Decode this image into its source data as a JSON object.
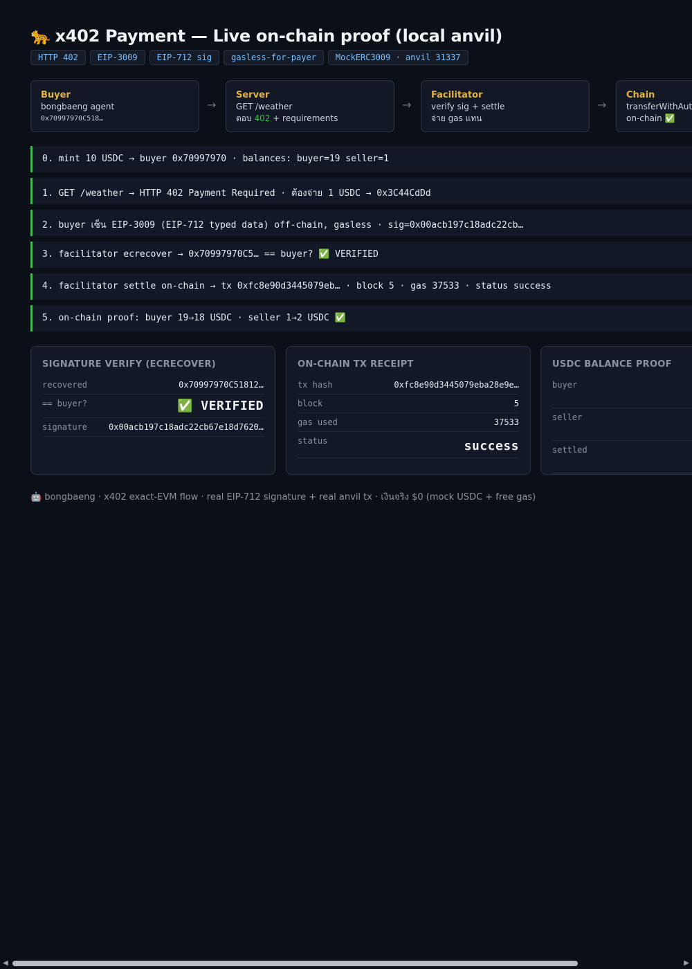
{
  "header": {
    "emoji": "🐆",
    "title": "x402 Payment — Live on-chain proof (local anvil)",
    "badges": [
      "HTTP 402",
      "EIP-3009",
      "EIP-712 sig",
      "gasless-for-payer",
      "MockERC3009 · anvil 31337"
    ]
  },
  "flow": {
    "arrow": "→",
    "cards": [
      {
        "name": "Buyer",
        "line1": "bongbaeng agent",
        "line2": "0x70997970C518…"
      },
      {
        "name": "Server",
        "line1": "GET /weather",
        "line2_pre": "ตอบ ",
        "line2_hl": "402",
        "line2_post": " + requirements"
      },
      {
        "name": "Facilitator",
        "line1": "verify sig + settle",
        "line2": "จ่าย gas แทน"
      },
      {
        "name": "Chain",
        "line1": "transferWithAuth",
        "line2": "on-chain ✅"
      }
    ]
  },
  "steps": [
    "0. mint 10 USDC → buyer 0x70997970 · balances: buyer=19 seller=1",
    "1. GET /weather → HTTP 402 Payment Required · ต้องจ่าย 1 USDC → 0x3C44CdDd",
    "2. buyer เซ็น EIP-3009 (EIP-712 typed data) off-chain, gasless · sig=0x00acb197c18adc22cb…",
    "3. facilitator ecrecover → 0x70997970C5… == buyer? ✅ VERIFIED",
    "4. facilitator settle on-chain → tx 0xfc8e90d3445079eb… · block 5 · gas 37533 · status success",
    "5. on-chain proof: buyer 19→18 USDC · seller 1→2 USDC ✅"
  ],
  "panels": {
    "signature": {
      "title": "SIGNATURE VERIFY (ECRECOVER)",
      "rows": [
        {
          "label": "recovered",
          "value": "0x70997970C51812…"
        },
        {
          "label": "== buyer?",
          "value": "✅ VERIFIED"
        },
        {
          "label": "signature",
          "value": "0x00acb197c18adc22cb67e18d7620…"
        }
      ]
    },
    "receipt": {
      "title": "ON-CHAIN TX RECEIPT",
      "rows": [
        {
          "label": "tx hash",
          "value": "0xfc8e90d3445079eba28e9e…"
        },
        {
          "label": "block",
          "value": "5"
        },
        {
          "label": "gas used",
          "value": "37533"
        },
        {
          "label": "status",
          "value": "success"
        }
      ]
    },
    "balance": {
      "title": "USDC BALANCE PROOF",
      "rows": [
        {
          "label": "buyer"
        },
        {
          "label": "seller"
        },
        {
          "label": "settled"
        }
      ]
    }
  },
  "footer": {
    "icon": "🤖",
    "text": "bongbaeng · x402 exact-EVM flow · real EIP-712 signature + real anvil tx · เงินจริง $0 (mock USDC + free gas)"
  },
  "scrollbar": {
    "left_arrow": "◀",
    "right_arrow": "▶"
  }
}
